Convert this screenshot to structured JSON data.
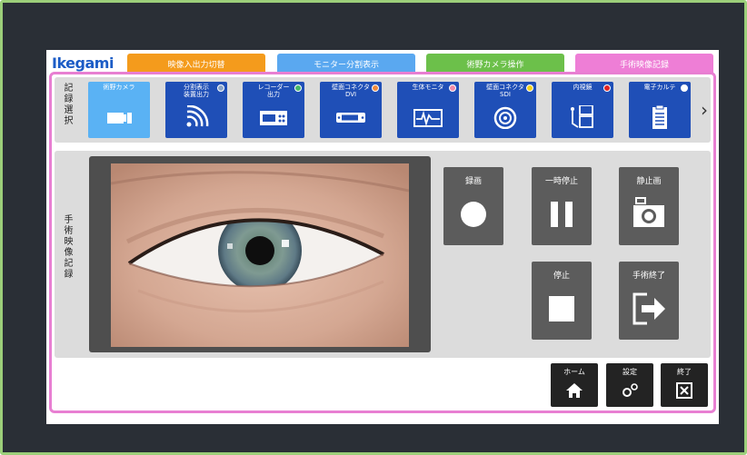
{
  "brand": {
    "logo_text": "Ikegami"
  },
  "tabs": [
    {
      "label": "映像入出力切替",
      "color": "#f49b1c"
    },
    {
      "label": "モニター分割表示",
      "color": "#5aa8f0"
    },
    {
      "label": "術野カメラ操作",
      "color": "#6cc04a"
    },
    {
      "label": "手術映像記録",
      "color": "#ee7ed6",
      "active": true
    }
  ],
  "source_select": {
    "section_label": "記録選択",
    "items": [
      {
        "label": "術野カメラ",
        "icon": "camera-icon",
        "selected": true,
        "dot": ""
      },
      {
        "label": "分割表示\n装置出力",
        "icon": "signal-icon",
        "selected": false,
        "dot": "#8aa4c8"
      },
      {
        "label": "レコーダー\n出力",
        "icon": "recorder-icon",
        "selected": false,
        "dot": "#46b86a"
      },
      {
        "label": "壁面コネクタ\nDVI",
        "icon": "dvi-connector-icon",
        "selected": false,
        "dot": "#f08a3c"
      },
      {
        "label": "生体モニタ",
        "icon": "vital-monitor-icon",
        "selected": false,
        "dot": "#f08aa8"
      },
      {
        "label": "壁面コネクタ\nSDI",
        "icon": "sdi-connector-icon",
        "selected": false,
        "dot": "#f2d21c"
      },
      {
        "label": "内視鏡",
        "icon": "endoscope-icon",
        "selected": false,
        "dot": "#e02424"
      },
      {
        "label": "電子カルテ",
        "icon": "clipboard-icon",
        "selected": false,
        "dot": "#ffffff"
      }
    ],
    "next_icon": "chevron-right-icon"
  },
  "recording": {
    "section_label": "手術映像記録",
    "controls": {
      "record": "録画",
      "pause": "一時停止",
      "still": "静止画",
      "stop": "停止",
      "end_surgery": "手術終了"
    }
  },
  "footer": {
    "home": "ホーム",
    "settings": "設定",
    "exit": "終了"
  }
}
